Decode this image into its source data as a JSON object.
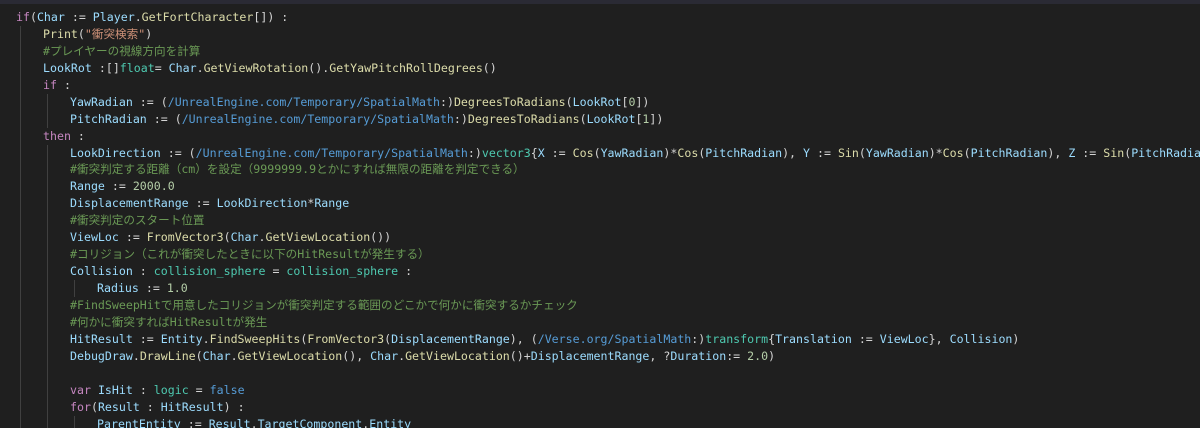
{
  "editor": {
    "lines": [
      {
        "indent": 0,
        "tokens": [
          [
            "kw",
            "if"
          ],
          [
            "txt",
            "("
          ],
          [
            "var",
            "Char"
          ],
          [
            "txt",
            " := "
          ],
          [
            "var",
            "Player"
          ],
          [
            "txt",
            "."
          ],
          [
            "fn",
            "GetFortCharacter"
          ],
          [
            "txt",
            "[]) :"
          ]
        ]
      },
      {
        "indent": 1,
        "tokens": [
          [
            "fn",
            "Print"
          ],
          [
            "txt",
            "("
          ],
          [
            "str",
            "\"衝突検索\""
          ],
          [
            "txt",
            ")"
          ]
        ]
      },
      {
        "indent": 1,
        "tokens": [
          [
            "cmt",
            "#プレイヤーの視線方向を計算"
          ]
        ]
      },
      {
        "indent": 1,
        "tokens": [
          [
            "var",
            "LookRot"
          ],
          [
            "txt",
            " :[]"
          ],
          [
            "ty",
            "float"
          ],
          [
            "txt",
            "= "
          ],
          [
            "var",
            "Char"
          ],
          [
            "txt",
            "."
          ],
          [
            "fn",
            "GetViewRotation"
          ],
          [
            "txt",
            "()."
          ],
          [
            "fn",
            "GetYawPitchRollDegrees"
          ],
          [
            "txt",
            "()"
          ]
        ]
      },
      {
        "indent": 1,
        "tokens": [
          [
            "kw",
            "if"
          ],
          [
            "txt",
            " :"
          ]
        ]
      },
      {
        "indent": 2,
        "tokens": [
          [
            "var",
            "YawRadian"
          ],
          [
            "txt",
            " := ("
          ],
          [
            "path",
            "/UnrealEngine.com/Temporary/SpatialMath"
          ],
          [
            "txt",
            ":)"
          ],
          [
            "fn",
            "DegreesToRadians"
          ],
          [
            "txt",
            "("
          ],
          [
            "var",
            "LookRot"
          ],
          [
            "txt",
            "["
          ],
          [
            "num",
            "0"
          ],
          [
            "txt",
            "])"
          ]
        ]
      },
      {
        "indent": 2,
        "tokens": [
          [
            "var",
            "PitchRadian"
          ],
          [
            "txt",
            " := ("
          ],
          [
            "path",
            "/UnrealEngine.com/Temporary/SpatialMath"
          ],
          [
            "txt",
            ":)"
          ],
          [
            "fn",
            "DegreesToRadians"
          ],
          [
            "txt",
            "("
          ],
          [
            "var",
            "LookRot"
          ],
          [
            "txt",
            "["
          ],
          [
            "num",
            "1"
          ],
          [
            "txt",
            "])"
          ]
        ]
      },
      {
        "indent": 1,
        "tokens": [
          [
            "kw",
            "then"
          ],
          [
            "txt",
            " :"
          ]
        ]
      },
      {
        "indent": 2,
        "tokens": [
          [
            "var",
            "LookDirection"
          ],
          [
            "txt",
            " := ("
          ],
          [
            "path",
            "/UnrealEngine.com/Temporary/SpatialMath"
          ],
          [
            "txt",
            ":)"
          ],
          [
            "ty",
            "vector3"
          ],
          [
            "txt",
            "{"
          ],
          [
            "var",
            "X"
          ],
          [
            "txt",
            " := "
          ],
          [
            "fn",
            "Cos"
          ],
          [
            "txt",
            "("
          ],
          [
            "var",
            "YawRadian"
          ],
          [
            "txt",
            ")*"
          ],
          [
            "fn",
            "Cos"
          ],
          [
            "txt",
            "("
          ],
          [
            "var",
            "PitchRadian"
          ],
          [
            "txt",
            "), "
          ],
          [
            "var",
            "Y"
          ],
          [
            "txt",
            " := "
          ],
          [
            "fn",
            "Sin"
          ],
          [
            "txt",
            "("
          ],
          [
            "var",
            "YawRadian"
          ],
          [
            "txt",
            ")*"
          ],
          [
            "fn",
            "Cos"
          ],
          [
            "txt",
            "("
          ],
          [
            "var",
            "PitchRadian"
          ],
          [
            "txt",
            "), "
          ],
          [
            "var",
            "Z"
          ],
          [
            "txt",
            " := "
          ],
          [
            "fn",
            "Sin"
          ],
          [
            "txt",
            "("
          ],
          [
            "var",
            "PitchRadian"
          ],
          [
            "txt",
            ")}"
          ]
        ]
      },
      {
        "indent": 2,
        "tokens": [
          [
            "cmt",
            "#衝突判定する距離（cm）を設定（9999999.9とかにすれば無限の距離を判定できる）"
          ]
        ]
      },
      {
        "indent": 2,
        "tokens": [
          [
            "var",
            "Range"
          ],
          [
            "txt",
            " := "
          ],
          [
            "num",
            "2000.0"
          ]
        ]
      },
      {
        "indent": 2,
        "tokens": [
          [
            "var",
            "DisplacementRange"
          ],
          [
            "txt",
            " := "
          ],
          [
            "var",
            "LookDirection"
          ],
          [
            "txt",
            "*"
          ],
          [
            "var",
            "Range"
          ]
        ]
      },
      {
        "indent": 2,
        "tokens": [
          [
            "cmt",
            "#衝突判定のスタート位置"
          ]
        ]
      },
      {
        "indent": 2,
        "tokens": [
          [
            "var",
            "ViewLoc"
          ],
          [
            "txt",
            " := "
          ],
          [
            "fn",
            "FromVector3"
          ],
          [
            "txt",
            "("
          ],
          [
            "var",
            "Char"
          ],
          [
            "txt",
            "."
          ],
          [
            "fn",
            "GetViewLocation"
          ],
          [
            "txt",
            "())"
          ]
        ]
      },
      {
        "indent": 2,
        "tokens": [
          [
            "cmt",
            "#コリジョン（これが衝突したときに以下のHitResultが発生する）"
          ]
        ]
      },
      {
        "indent": 2,
        "tokens": [
          [
            "var",
            "Collision"
          ],
          [
            "txt",
            " : "
          ],
          [
            "ty",
            "collision_sphere"
          ],
          [
            "txt",
            " = "
          ],
          [
            "ty",
            "collision_sphere"
          ],
          [
            "txt",
            " :"
          ]
        ]
      },
      {
        "indent": 3,
        "tokens": [
          [
            "var",
            "Radius"
          ],
          [
            "txt",
            " := "
          ],
          [
            "num",
            "1.0"
          ]
        ]
      },
      {
        "indent": 2,
        "tokens": [
          [
            "cmt",
            "#FindSweepHitで用意したコリジョンが衝突判定する範囲のどこかで何かに衝突するかチェック"
          ]
        ]
      },
      {
        "indent": 2,
        "tokens": [
          [
            "cmt",
            "#何かに衝突すればHitResultが発生"
          ]
        ]
      },
      {
        "indent": 2,
        "tokens": [
          [
            "var",
            "HitResult"
          ],
          [
            "txt",
            " := "
          ],
          [
            "var",
            "Entity"
          ],
          [
            "txt",
            "."
          ],
          [
            "fn",
            "FindSweepHits"
          ],
          [
            "txt",
            "("
          ],
          [
            "fn",
            "FromVector3"
          ],
          [
            "txt",
            "("
          ],
          [
            "var",
            "DisplacementRange"
          ],
          [
            "txt",
            "), ("
          ],
          [
            "path",
            "/Verse.org/SpatialMath"
          ],
          [
            "txt",
            ":)"
          ],
          [
            "ty",
            "transform"
          ],
          [
            "txt",
            "{"
          ],
          [
            "var",
            "Translation"
          ],
          [
            "txt",
            " := "
          ],
          [
            "var",
            "ViewLoc"
          ],
          [
            "txt",
            "}, "
          ],
          [
            "var",
            "Collision"
          ],
          [
            "txt",
            ")"
          ]
        ]
      },
      {
        "indent": 2,
        "tokens": [
          [
            "var",
            "DebugDraw"
          ],
          [
            "txt",
            "."
          ],
          [
            "fn",
            "DrawLine"
          ],
          [
            "txt",
            "("
          ],
          [
            "var",
            "Char"
          ],
          [
            "txt",
            "."
          ],
          [
            "fn",
            "GetViewLocation"
          ],
          [
            "txt",
            "(), "
          ],
          [
            "var",
            "Char"
          ],
          [
            "txt",
            "."
          ],
          [
            "fn",
            "GetViewLocation"
          ],
          [
            "txt",
            "()+"
          ],
          [
            "var",
            "DisplacementRange"
          ],
          [
            "txt",
            ", ?"
          ],
          [
            "var",
            "Duration"
          ],
          [
            "txt",
            ":= "
          ],
          [
            "num",
            "2.0"
          ],
          [
            "txt",
            ")"
          ]
        ]
      },
      {
        "indent": 2,
        "tokens": []
      },
      {
        "indent": 2,
        "tokens": [
          [
            "kw",
            "var"
          ],
          [
            "txt",
            " "
          ],
          [
            "var",
            "IsHit"
          ],
          [
            "txt",
            " : "
          ],
          [
            "ty",
            "logic"
          ],
          [
            "txt",
            " = "
          ],
          [
            "bool",
            "false"
          ]
        ]
      },
      {
        "indent": 2,
        "tokens": [
          [
            "kw",
            "for"
          ],
          [
            "txt",
            "("
          ],
          [
            "var",
            "Result"
          ],
          [
            "txt",
            " : "
          ],
          [
            "var",
            "HitResult"
          ],
          [
            "txt",
            ") :"
          ]
        ]
      },
      {
        "indent": 3,
        "tokens": [
          [
            "var",
            "ParentEntity"
          ],
          [
            "txt",
            " := "
          ],
          [
            "var",
            "Result"
          ],
          [
            "txt",
            "."
          ],
          [
            "var",
            "TargetComponent"
          ],
          [
            "txt",
            "."
          ],
          [
            "var",
            "Entity"
          ]
        ]
      }
    ]
  }
}
